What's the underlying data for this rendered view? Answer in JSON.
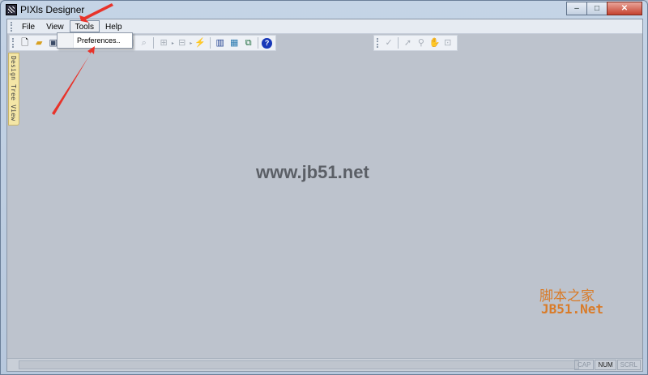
{
  "window": {
    "title": "PIXls Designer",
    "minimize_glyph": "–",
    "maximize_glyph": "□",
    "close_glyph": "✕"
  },
  "menubar": {
    "items": [
      "File",
      "View",
      "Tools",
      "Help"
    ],
    "active_index": 2
  },
  "tools_menu": {
    "items": [
      "Preferences.."
    ]
  },
  "toolbar_left": {
    "icons": [
      "new-file-icon",
      "open-folder-icon",
      "save-icon",
      "undo-icon",
      "redo-icon",
      "cut-icon",
      "copy-icon",
      "paste-icon",
      "zoom-icon",
      "group-icon",
      "ungroup-icon",
      "wizard-icon",
      "build-icon",
      "deploy-icon",
      "network-icon",
      "help-icon"
    ]
  },
  "toolbar_right": {
    "icons": [
      "check-icon",
      "pointer-icon",
      "magnify-icon",
      "hand-icon",
      "fit-icon"
    ]
  },
  "side_panel": {
    "tab_label": "Design Tree View"
  },
  "watermark": {
    "site": "www.jb51.net",
    "logo_cn": "脚本之家",
    "logo_en": "JB51.Net"
  },
  "statusbar": {
    "panels": [
      {
        "label": "CAP",
        "on": false
      },
      {
        "label": "NUM",
        "on": true
      },
      {
        "label": "SCRL",
        "on": false
      }
    ]
  },
  "colors": {
    "annotation_arrow": "#e8332a",
    "logo": "#d97b28",
    "side_tab": "#f4e6a6"
  }
}
